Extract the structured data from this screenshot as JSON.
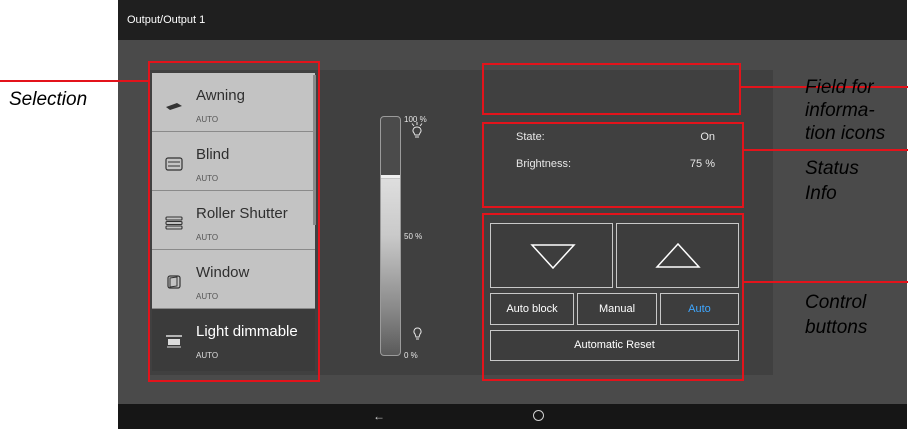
{
  "window": {
    "title": "Output/Output 1"
  },
  "selection": {
    "items": [
      {
        "label": "Awning",
        "mode": "AUTO",
        "icon": "awning-icon"
      },
      {
        "label": "Blind",
        "mode": "AUTO",
        "icon": "blind-icon"
      },
      {
        "label": "Roller Shutter",
        "mode": "AUTO",
        "icon": "roller-shutter-icon"
      },
      {
        "label": "Window",
        "mode": "AUTO",
        "icon": "window-icon"
      },
      {
        "label": "Light dimmable",
        "mode": "AUTO",
        "icon": "light-icon",
        "active": true
      }
    ]
  },
  "slider": {
    "max_label": "100 %",
    "mid_label": "50 %",
    "min_label": "0 %",
    "value_percent": 75
  },
  "status": {
    "state_label": "State:",
    "state_value": "On",
    "brightness_label": "Brightness:",
    "brightness_value": "75 %"
  },
  "controls": {
    "auto_block": "Auto block",
    "manual": "Manual",
    "auto": "Auto",
    "automatic_reset": "Automatic Reset",
    "auto_color": "#3fa7ff"
  },
  "annotations": {
    "selection": "Selection",
    "field_info_1": "Field for",
    "field_info_2": "informa-",
    "field_info_3": "tion icons",
    "status_1": "Status",
    "status_2": "Info",
    "control_1": "Control",
    "control_2": "buttons"
  },
  "colors": {
    "annotation_red": "#e3131b",
    "panel": "#404040",
    "title_bar": "#1f1f1f"
  }
}
